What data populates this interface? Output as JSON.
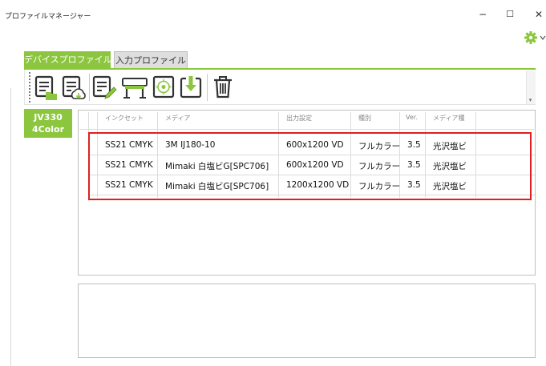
{
  "window": {
    "title": "プロファイルマネージャー",
    "minimize": "−",
    "maximize": "☐",
    "close": "✕"
  },
  "tabs": [
    {
      "label": "デバイスプロファイル",
      "active": true
    },
    {
      "label": "入力プロファイル",
      "active": false
    }
  ],
  "toolbar": {
    "icons": [
      "open-profile-icon",
      "download-profile-icon",
      "edit-profile-icon",
      "printer-icon",
      "target-icon",
      "export-icon",
      "trash-icon"
    ]
  },
  "device": {
    "line1": "JV330",
    "line2": "4Color"
  },
  "table": {
    "columns": [
      "インクセット",
      "メディア",
      "出力設定",
      "種別",
      "Ver.",
      "メディア種"
    ],
    "rows": [
      [
        "SS21 CMYK",
        "3M IJ180-10",
        "600x1200 VD",
        "フルカラー",
        "3.5",
        "光沢塩ビ"
      ],
      [
        "SS21 CMYK",
        "Mimaki 白塩ビG[SPC706]",
        "600x1200 VD",
        "フルカラー",
        "3.5",
        "光沢塩ビ"
      ],
      [
        "SS21 CMYK",
        "Mimaki 白塩ビG[SPC706]",
        "1200x1200 VD",
        "フルカラー",
        "3.5",
        "光沢塩ビ"
      ]
    ]
  },
  "colors": {
    "accent": "#8cc63f",
    "highlight": "#e02020"
  }
}
